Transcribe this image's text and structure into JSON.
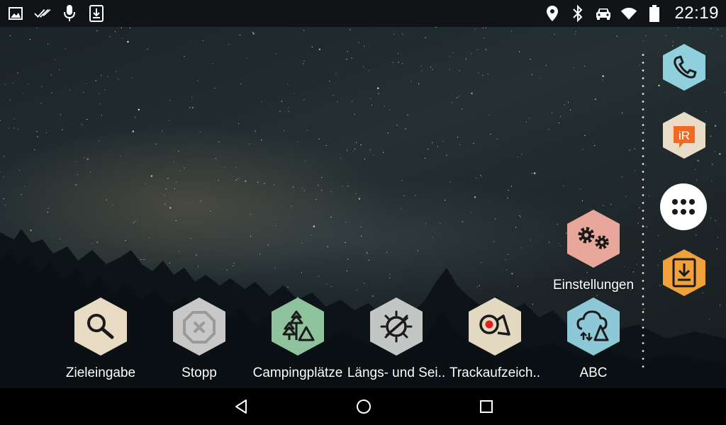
{
  "status_bar": {
    "left_icons": [
      "image-icon",
      "double-check-icon",
      "microphone-icon",
      "download-icon"
    ],
    "right_icons": [
      "location-pin-icon",
      "bluetooth-icon",
      "car-icon",
      "wifi-icon",
      "battery-icon"
    ],
    "time": "22:19"
  },
  "apps": [
    {
      "name": "app-zieleingabe",
      "label": "Zieleingabe",
      "icon": "search-icon",
      "color": "#e7dcc3"
    },
    {
      "name": "app-stopp",
      "label": "Stopp",
      "icon": "stop-icon",
      "color": "#c8c8c8"
    },
    {
      "name": "app-campingplaetze",
      "label": "Campingplätze",
      "icon": "camping-icon",
      "color": "#8fc39d"
    },
    {
      "name": "app-laengs-und-sei",
      "label": "Längs- und Sei..",
      "icon": "tilt-sensor-icon",
      "color": "#c4c6c6"
    },
    {
      "name": "app-trackaufzeich",
      "label": "Trackaufzeich..",
      "icon": "track-record-icon",
      "color": "#e3d9c1"
    },
    {
      "name": "app-abc",
      "label": "ABC",
      "icon": "cloud-signal-icon",
      "color": "#8cc8d6"
    },
    {
      "name": "app-einstellungen",
      "label": "Einstellungen",
      "icon": "gears-icon",
      "color": "#e8a79a"
    }
  ],
  "dock": {
    "phone": {
      "icon": "phone-icon",
      "color": "#8fd0dc"
    },
    "ir": {
      "icon": "ir-icon",
      "text": "iR",
      "color": "#e9ddc7",
      "accent": "#f26a21"
    },
    "launcher": {
      "icon": "app-drawer-icon",
      "color": "#ffffff"
    },
    "download": {
      "icon": "download-box-icon",
      "color": "#f0a13a"
    }
  },
  "nav": {
    "back": "back-icon",
    "home": "home-icon",
    "recents": "recents-icon"
  }
}
